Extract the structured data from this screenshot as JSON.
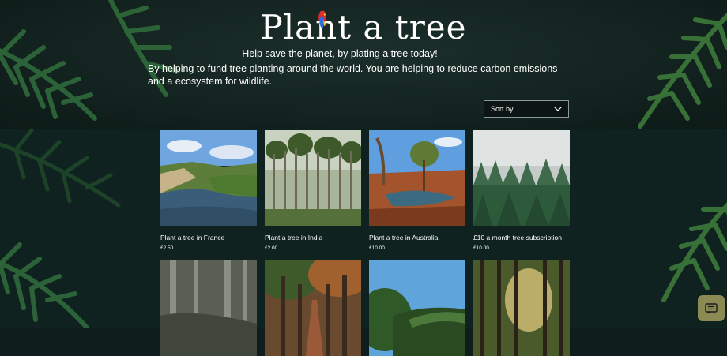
{
  "header": {
    "title": "Plant a tree",
    "subtitle": "Help save the planet, by plating a tree today!",
    "description": "By helping to fund tree planting around the world. You are helping to reduce carbon emissions and a ecosystem for wildlife."
  },
  "sort": {
    "label": "Sort by",
    "icon": "chevron-down-icon"
  },
  "products": [
    {
      "name": "Plant a tree in France",
      "price": "£2.50"
    },
    {
      "name": "Plant a tree in India",
      "price": "£2.00"
    },
    {
      "name": "Plant a tree in Australia",
      "price": "£10.00"
    },
    {
      "name": "£10 a month tree subscription",
      "price": "£10.00"
    },
    {
      "name": "",
      "price": ""
    },
    {
      "name": "",
      "price": ""
    },
    {
      "name": "",
      "price": ""
    },
    {
      "name": "",
      "price": ""
    }
  ],
  "chat": {
    "icon": "chat-icon"
  },
  "colors": {
    "background": "#0f1e1c",
    "chat": "#8a8a52"
  }
}
